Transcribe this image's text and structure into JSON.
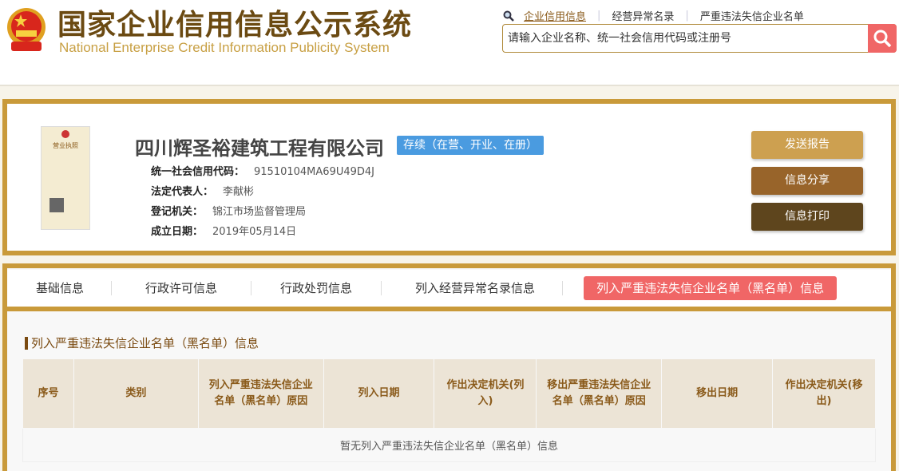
{
  "header": {
    "title_cn": "国家企业信用信息公示系统",
    "title_en": "National Enterprise Credit Information Publicity System",
    "links": [
      "企业信用信息",
      "经营异常名录",
      "严重违法失信企业名单"
    ],
    "search_placeholder": "请输入企业名称、统一社会信用代码或注册号"
  },
  "company": {
    "name": "四川辉圣裕建筑工程有限公司",
    "status": "存续（在营、开业、在册）",
    "fields": [
      {
        "label": "统一社会信用代码：",
        "value": "91510104MA69U49D4J"
      },
      {
        "label": "法定代表人：",
        "value": "李献彬"
      },
      {
        "label": "登记机关：",
        "value": "锦江市场监督管理局"
      },
      {
        "label": "成立日期：",
        "value": "2019年05月14日"
      }
    ],
    "license_text": "营业执照"
  },
  "actions": {
    "send": "发送报告",
    "share": "信息分享",
    "print": "信息打印"
  },
  "tabs": [
    "基础信息",
    "行政许可信息",
    "行政处罚信息",
    "列入经营异常名录信息",
    "列入严重违法失信企业名单（黑名单）信息"
  ],
  "section": {
    "title": "列入严重违法失信企业名单（黑名单）信息",
    "columns": [
      "序号",
      "类别",
      "列入严重违法失信企业名单（黑名单）原因",
      "列入日期",
      "作出决定机关(列入)",
      "移出严重违法失信企业名单（黑名单）原因",
      "移出日期",
      "作出决定机关(移出)"
    ],
    "empty": "暂无列入严重违法失信企业名单（黑名单）信息"
  },
  "colors": {
    "gold": "#c99a3a",
    "accent": "#f06666",
    "status": "#4a9be0"
  }
}
